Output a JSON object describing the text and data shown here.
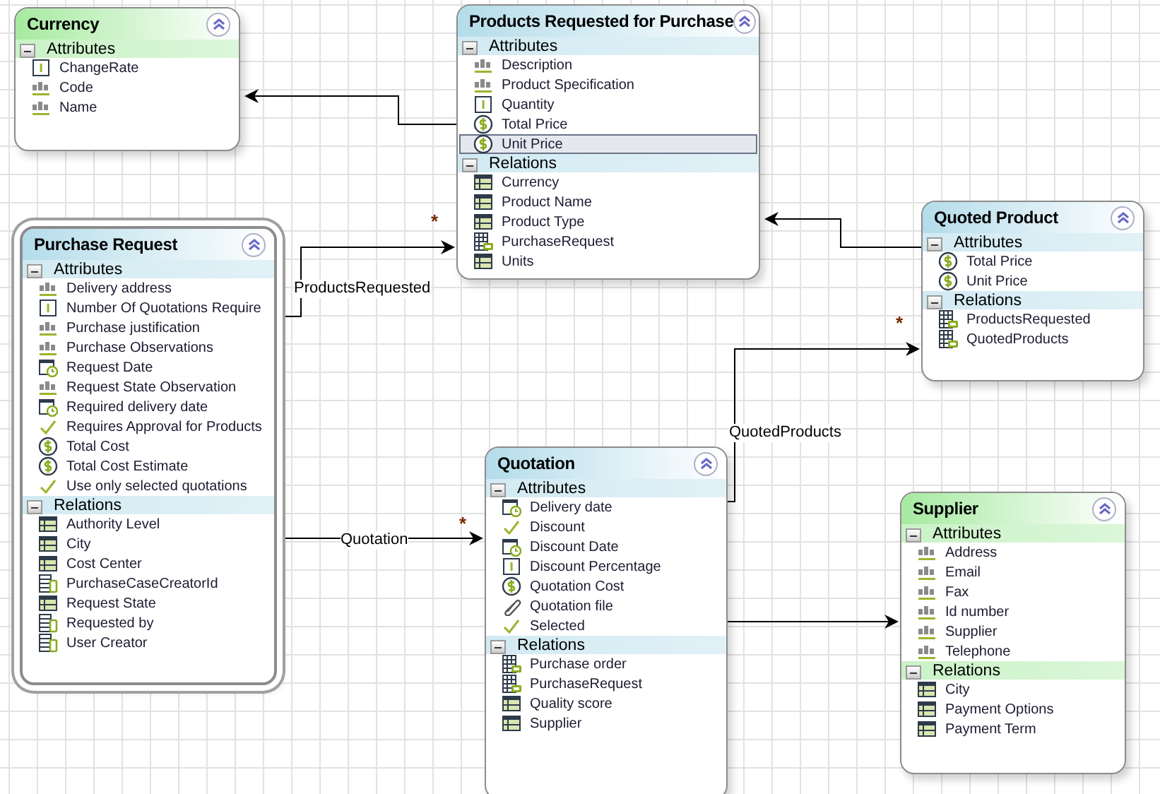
{
  "entities": [
    {
      "title": "Currency",
      "color": "#a6eaa0",
      "selected": false,
      "sections": [
        {
          "title": "Attributes",
          "items": [
            {
              "label": "ChangeRate",
              "kind": "number",
              "selected": false
            },
            {
              "label": "Code",
              "kind": "text",
              "selected": false
            },
            {
              "label": "Name",
              "kind": "text",
              "selected": false
            }
          ]
        }
      ]
    },
    {
      "title": "Products Requested for Purchase",
      "color": "#b4dcea",
      "selected": false,
      "sections": [
        {
          "title": "Attributes",
          "items": [
            {
              "label": "Description",
              "kind": "text",
              "selected": false
            },
            {
              "label": "Product Specification",
              "kind": "text",
              "selected": false
            },
            {
              "label": "Quantity",
              "kind": "number",
              "selected": false
            },
            {
              "label": "Total Price",
              "kind": "money",
              "selected": false
            },
            {
              "label": "Unit Price",
              "kind": "money",
              "selected": true
            }
          ]
        },
        {
          "title": "Relations",
          "items": [
            {
              "label": "Currency",
              "kind": "table",
              "selected": false
            },
            {
              "label": "Product Name",
              "kind": "table",
              "selected": false
            },
            {
              "label": "Product Type",
              "kind": "table",
              "selected": false
            },
            {
              "label": "PurchaseRequest",
              "kind": "table-link",
              "selected": false
            },
            {
              "label": "Units",
              "kind": "table",
              "selected": false
            }
          ]
        }
      ]
    },
    {
      "title": "Purchase Request",
      "color": "#b4dcea",
      "selected": true,
      "sections": [
        {
          "title": "Attributes",
          "items": [
            {
              "label": "Delivery address",
              "kind": "text",
              "selected": false
            },
            {
              "label": "Number Of Quotations Require",
              "kind": "number",
              "selected": false
            },
            {
              "label": "Purchase justification",
              "kind": "text",
              "selected": false
            },
            {
              "label": "Purchase Observations",
              "kind": "text",
              "selected": false
            },
            {
              "label": "Request Date",
              "kind": "date",
              "selected": false
            },
            {
              "label": "Request State Observation",
              "kind": "text",
              "selected": false
            },
            {
              "label": "Required delivery date",
              "kind": "date",
              "selected": false
            },
            {
              "label": "Requires Approval for Products",
              "kind": "check",
              "selected": false
            },
            {
              "label": "Total Cost",
              "kind": "money",
              "selected": false
            },
            {
              "label": "Total Cost Estimate",
              "kind": "money",
              "selected": false
            },
            {
              "label": "Use only selected quotations",
              "kind": "check",
              "selected": false
            }
          ]
        },
        {
          "title": "Relations",
          "items": [
            {
              "label": "Authority Level",
              "kind": "table",
              "selected": false
            },
            {
              "label": "City",
              "kind": "table",
              "selected": false
            },
            {
              "label": "Cost Center",
              "kind": "table",
              "selected": false
            },
            {
              "label": "PurchaseCaseCreatorId",
              "kind": "table-form",
              "selected": false
            },
            {
              "label": "Request State",
              "kind": "table",
              "selected": false
            },
            {
              "label": "Requested by",
              "kind": "table-form",
              "selected": false
            },
            {
              "label": "User Creator",
              "kind": "table-form",
              "selected": false
            }
          ]
        }
      ]
    },
    {
      "title": "Quoted Product",
      "color": "#b4dcea",
      "selected": false,
      "sections": [
        {
          "title": "Attributes",
          "items": [
            {
              "label": "Total Price",
              "kind": "money",
              "selected": false
            },
            {
              "label": "Unit Price",
              "kind": "money",
              "selected": false
            }
          ]
        },
        {
          "title": "Relations",
          "items": [
            {
              "label": "ProductsRequested",
              "kind": "table-link",
              "selected": false
            },
            {
              "label": "QuotedProducts",
              "kind": "table-link",
              "selected": false
            }
          ]
        }
      ]
    },
    {
      "title": "Quotation",
      "color": "#b4dcea",
      "selected": false,
      "sections": [
        {
          "title": "Attributes",
          "items": [
            {
              "label": "Delivery date",
              "kind": "date",
              "selected": false
            },
            {
              "label": "Discount",
              "kind": "check",
              "selected": false
            },
            {
              "label": "Discount Date",
              "kind": "date",
              "selected": false
            },
            {
              "label": "Discount Percentage",
              "kind": "number",
              "selected": false
            },
            {
              "label": "Quotation Cost",
              "kind": "money",
              "selected": false
            },
            {
              "label": "Quotation file",
              "kind": "file",
              "selected": false
            },
            {
              "label": "Selected",
              "kind": "check",
              "selected": false
            }
          ]
        },
        {
          "title": "Relations",
          "items": [
            {
              "label": "Purchase order",
              "kind": "table-link",
              "selected": false
            },
            {
              "label": "PurchaseRequest",
              "kind": "table-link",
              "selected": false
            },
            {
              "label": "Quality score",
              "kind": "table",
              "selected": false
            },
            {
              "label": "Supplier",
              "kind": "table",
              "selected": false
            }
          ]
        }
      ]
    },
    {
      "title": "Supplier",
      "color": "#a6eaa0",
      "selected": false,
      "sections": [
        {
          "title": "Attributes",
          "items": [
            {
              "label": "Address",
              "kind": "text",
              "selected": false
            },
            {
              "label": "Email",
              "kind": "text",
              "selected": false
            },
            {
              "label": "Fax",
              "kind": "text",
              "selected": false
            },
            {
              "label": "Id number",
              "kind": "text",
              "selected": false
            },
            {
              "label": "Supplier",
              "kind": "text",
              "selected": false
            },
            {
              "label": "Telephone",
              "kind": "text",
              "selected": false
            }
          ]
        },
        {
          "title": "Relations",
          "items": [
            {
              "label": "City",
              "kind": "table",
              "selected": false
            },
            {
              "label": "Payment Options",
              "kind": "table",
              "selected": false
            },
            {
              "label": "Payment Term",
              "kind": "table",
              "selected": false
            }
          ]
        }
      ]
    }
  ],
  "connectors": [
    {
      "kind": "arrow"
    },
    {
      "kind": "arrow",
      "label": "ProductsRequested",
      "mark": "*"
    },
    {
      "kind": "arrow"
    },
    {
      "kind": "arrow",
      "label": "QuotedProducts",
      "mark": "*"
    },
    {
      "kind": "arrow",
      "label": "Quotation",
      "mark": "*"
    },
    {
      "kind": "arrow"
    }
  ]
}
